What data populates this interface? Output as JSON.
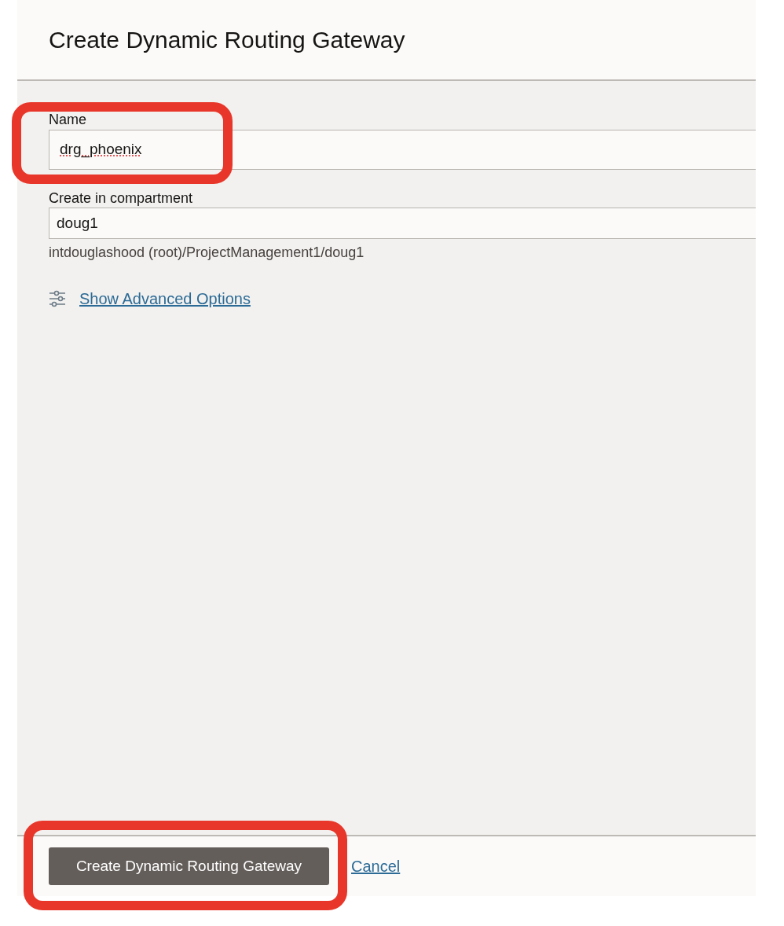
{
  "dialog": {
    "title": "Create Dynamic Routing Gateway"
  },
  "fields": [
    {
      "label": "Name",
      "value": "drg_phoenix",
      "kind": "text"
    },
    {
      "label": "Create in compartment",
      "value": "doug1",
      "kind": "select",
      "hint": "intdouglashood (root)/ProjectManagement1/doug1"
    }
  ],
  "advanced_link": "Show Advanced Options",
  "footer": {
    "primary_button": "Create Dynamic Routing Gateway",
    "cancel_link": "Cancel"
  },
  "annotations": [
    {
      "kind": "frame"
    },
    {
      "kind": "frame"
    }
  ]
}
